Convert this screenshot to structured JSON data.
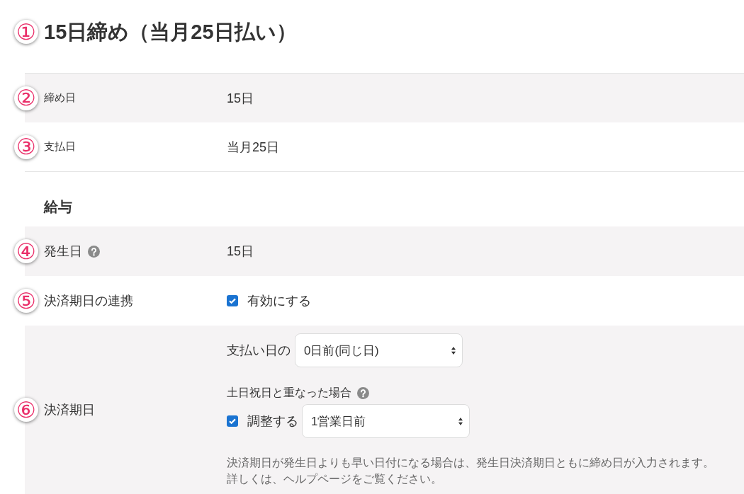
{
  "title": {
    "marker": "①",
    "text": "15日締め（当月25日払い）"
  },
  "summary": [
    {
      "marker": "②",
      "label": "締め日",
      "value": "15日"
    },
    {
      "marker": "③",
      "label": "支払日",
      "value": "当月25日"
    }
  ],
  "salary": {
    "heading": "給与",
    "rows": [
      {
        "kind": "text",
        "marker": "④",
        "label": "発生日",
        "help": true,
        "value": "15日"
      },
      {
        "kind": "checkbox",
        "marker": "⑤",
        "label": "決済期日の連携",
        "option": {
          "label": "有効にする",
          "checked": true
        }
      },
      {
        "kind": "settlement",
        "marker": "⑥",
        "label": "決済期日",
        "offset": {
          "label": "支払い日の",
          "select": "0日前(同じ日)"
        },
        "holiday": {
          "label": "土日祝日と重なった場合",
          "help": true,
          "adjust": {
            "label": "調整する",
            "checked": true
          },
          "select": "1営業日前"
        },
        "note": [
          "決済期日が発生日よりも早い日付になる場合は、発生日決済期日ともに締め日が入力されます。",
          "詳しくは、ヘルプページをご覧ください。"
        ]
      }
    ]
  }
}
